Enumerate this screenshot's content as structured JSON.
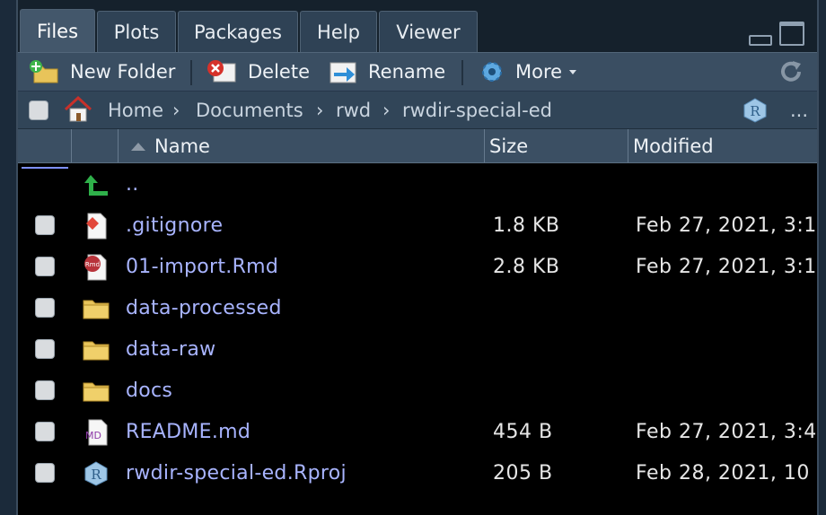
{
  "tabs": [
    {
      "label": "Files",
      "active": true
    },
    {
      "label": "Plots"
    },
    {
      "label": "Packages"
    },
    {
      "label": "Help"
    },
    {
      "label": "Viewer"
    }
  ],
  "toolbar": {
    "new_folder": "New Folder",
    "delete": "Delete",
    "rename": "Rename",
    "more": "More"
  },
  "path": {
    "home": "Home",
    "crumbs": [
      "Documents",
      "rwd",
      "rwdir-special-ed"
    ],
    "ellipsis": "..."
  },
  "columns": {
    "name": "Name",
    "size": "Size",
    "modified": "Modified"
  },
  "files": [
    {
      "name": "..",
      "icon": "up-arrow-icon",
      "size": "",
      "modified": ""
    },
    {
      "name": ".gitignore",
      "icon": "git-file-icon",
      "size": "1.8 KB",
      "modified": "Feb 27, 2021, 3:1"
    },
    {
      "name": "01-import.Rmd",
      "icon": "rmd-file-icon",
      "size": "2.8 KB",
      "modified": "Feb 27, 2021, 3:1"
    },
    {
      "name": "data-processed",
      "icon": "folder-icon",
      "size": "",
      "modified": ""
    },
    {
      "name": "data-raw",
      "icon": "folder-icon",
      "size": "",
      "modified": ""
    },
    {
      "name": "docs",
      "icon": "folder-icon",
      "size": "",
      "modified": ""
    },
    {
      "name": "README.md",
      "icon": "md-file-icon",
      "size": "454 B",
      "modified": "Feb 27, 2021, 3:4"
    },
    {
      "name": "rwdir-special-ed.Rproj",
      "icon": "rproj-file-icon",
      "size": "205 B",
      "modified": "Feb 28, 2021, 10"
    }
  ],
  "icon_text": {
    "rmd": "Rmd",
    "md": "MD",
    "r": "R"
  },
  "colors": {
    "link": "#a8b4ff",
    "accent": "#7f90ff",
    "folder": "#e8c45a",
    "git": "#e2473a"
  }
}
